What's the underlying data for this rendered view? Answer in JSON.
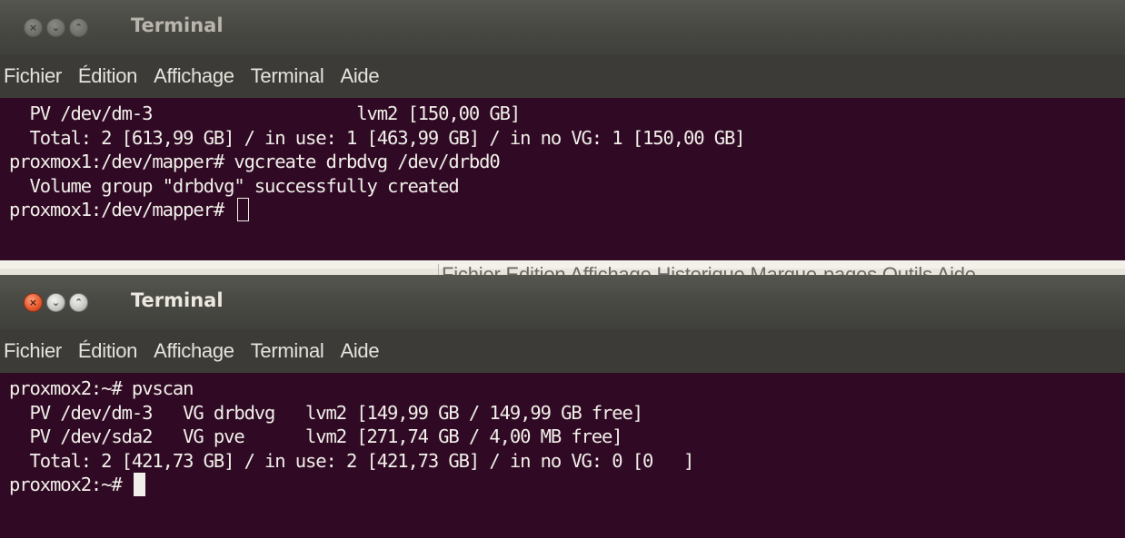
{
  "colors": {
    "terminal_bg": "#300a24",
    "terminal_fg": "#f1efe9",
    "titlebar_bg": "#4a4a45",
    "menubar_bg": "#3c3b37",
    "close_active": "#e4562c"
  },
  "window1": {
    "title": "Terminal",
    "buttons": [
      "close-icon",
      "minimize-icon",
      "maximize-icon"
    ],
    "menu": [
      "Fichier",
      "Édition",
      "Affichage",
      "Terminal",
      "Aide"
    ],
    "lines": [
      "  PV /dev/dm-3                    lvm2 [150,00 GB]",
      "  Total: 2 [613,99 GB] / in use: 1 [463,99 GB] / in no VG: 1 [150,00 GB]",
      "proxmox1:/dev/mapper# vgcreate drbdvg /dev/drbd0",
      "  Volume group \"drbdvg\" successfully created"
    ],
    "prompt": "proxmox1:/dev/mapper# "
  },
  "background_window": {
    "menu_text": "Fichier  Edition  Affichage  Historique  Marque-pages  Outils  Aide"
  },
  "window2": {
    "title": "Terminal",
    "buttons": [
      "close-icon",
      "minimize-icon",
      "maximize-icon"
    ],
    "menu": [
      "Fichier",
      "Édition",
      "Affichage",
      "Terminal",
      "Aide"
    ],
    "lines": [
      "proxmox2:~# pvscan",
      "  PV /dev/dm-3   VG drbdvg   lvm2 [149,99 GB / 149,99 GB free]",
      "  PV /dev/sda2   VG pve      lvm2 [271,74 GB / 4,00 MB free]",
      "  Total: 2 [421,73 GB] / in use: 2 [421,73 GB] / in no VG: 0 [0   ]"
    ],
    "prompt": "proxmox2:~# "
  }
}
